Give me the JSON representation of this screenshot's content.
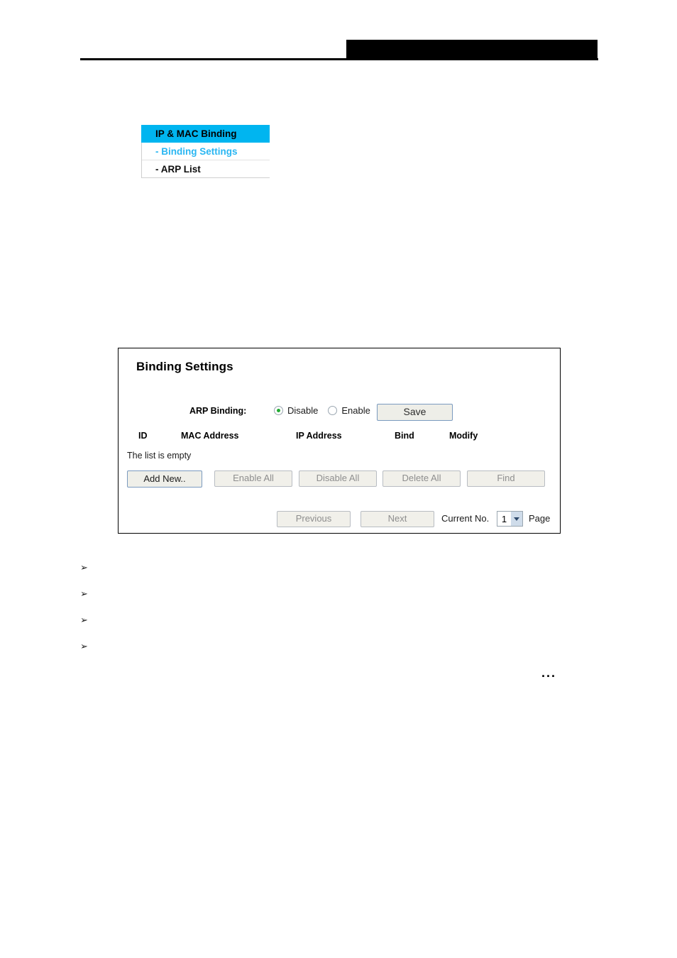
{
  "header": {
    "redaction_color": "#000000",
    "rule_color": "#000000"
  },
  "nav": {
    "heading": "IP & MAC Binding",
    "highlight_color": "#00b5f0",
    "selected_color": "#29b6f2",
    "items": [
      {
        "label": "- Binding Settings",
        "state": "selected"
      },
      {
        "label": "- ARP List",
        "state": "normal"
      }
    ]
  },
  "panel": {
    "title": "Binding Settings",
    "arp_binding": {
      "label": "ARP Binding:",
      "options": [
        {
          "label": "Disable",
          "checked": true
        },
        {
          "label": "Enable",
          "checked": false
        }
      ],
      "save_label": "Save"
    },
    "table": {
      "columns": [
        "ID",
        "MAC Address",
        "IP Address",
        "Bind",
        "Modify"
      ],
      "rows": [],
      "empty_message": "The list is empty"
    },
    "actions": [
      {
        "label": "Add New..",
        "enabled": true
      },
      {
        "label": "Enable All",
        "enabled": false
      },
      {
        "label": "Disable All",
        "enabled": false
      },
      {
        "label": "Delete All",
        "enabled": false
      },
      {
        "label": "Find",
        "enabled": false
      }
    ],
    "pagination": {
      "previous_label": "Previous",
      "previous_enabled": false,
      "next_label": "Next",
      "next_enabled": false,
      "current_label": "Current No.",
      "current_value": "1",
      "page_suffix": "Page"
    }
  },
  "notes": {
    "bullet_glyph": "➢",
    "items": [
      {
        "text": ""
      },
      {
        "text": ""
      },
      {
        "text": ""
      },
      {
        "text": ""
      }
    ],
    "ellipsis": "..."
  }
}
